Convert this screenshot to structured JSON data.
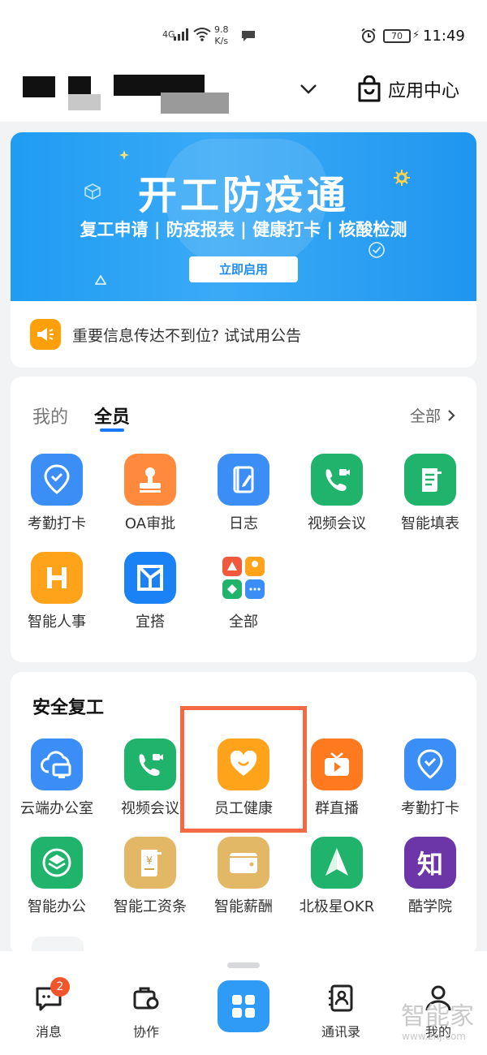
{
  "status_bar": {
    "network": "4G",
    "speed_value": "9.8",
    "speed_unit": "K/s",
    "battery": "70",
    "time": "11:49"
  },
  "header": {
    "app_center_label": "应用中心"
  },
  "banner": {
    "title": "开工防疫通",
    "subtitle": "复工申请 | 防疫报表 | 健康打卡 | 核酸检测",
    "button_label": "立即启用"
  },
  "notice": {
    "text": "重要信息传达不到位? 试试用公告"
  },
  "apps_section": {
    "tabs": [
      {
        "label": "我的",
        "active": false
      },
      {
        "label": "全员",
        "active": true
      }
    ],
    "see_all_label": "全部",
    "items": [
      {
        "label": "考勤打卡",
        "color": "#3b8ef5",
        "icon": "location-check-icon"
      },
      {
        "label": "OA审批",
        "color": "#ff8a3d",
        "icon": "stamp-icon"
      },
      {
        "label": "日志",
        "color": "#3b8ef5",
        "icon": "notebook-pen-icon"
      },
      {
        "label": "视频会议",
        "color": "#1fb36b",
        "icon": "video-phone-icon"
      },
      {
        "label": "智能填表",
        "color": "#1fb36b",
        "icon": "form-scroll-icon"
      },
      {
        "label": "智能人事",
        "color": "#ffa31a",
        "icon": "h-icon"
      },
      {
        "label": "宜搭",
        "color": "#1a82f5",
        "icon": "yida-icon"
      },
      {
        "label": "全部",
        "color": "#ffffff",
        "icon": "all-apps-icon"
      }
    ]
  },
  "safety_section": {
    "title": "安全复工",
    "items": [
      {
        "label": "云端办公室",
        "color": "#3b8ef5",
        "icon": "cloud-office-icon"
      },
      {
        "label": "视频会议",
        "color": "#1fb36b",
        "icon": "video-phone-icon"
      },
      {
        "label": "员工健康",
        "color": "#ffa31a",
        "icon": "heart-smile-icon"
      },
      {
        "label": "群直播",
        "color": "#ff7a1f",
        "icon": "live-tv-icon"
      },
      {
        "label": "考勤打卡",
        "color": "#3b8ef5",
        "icon": "location-check-icon"
      },
      {
        "label": "智能办公",
        "color": "#1fb36b",
        "icon": "layers-icon"
      },
      {
        "label": "智能工资条",
        "color": "#e2b766",
        "icon": "salary-slip-icon"
      },
      {
        "label": "智能薪酬",
        "color": "#e2b766",
        "icon": "wallet-icon"
      },
      {
        "label": "北极星OKR",
        "color": "#1fb36b",
        "icon": "compass-arrow-icon"
      },
      {
        "label": "酷学院",
        "color": "#6c35a8",
        "icon": "zhi-icon"
      }
    ],
    "zhi_glyph": "知",
    "salary_glyph": "¥"
  },
  "bottom_nav": {
    "items": [
      {
        "label": "消息",
        "badge": "2"
      },
      {
        "label": "协作"
      },
      {
        "label": "通讯录"
      },
      {
        "label": "我的"
      }
    ]
  },
  "watermark": {
    "main": "智能家",
    "sub": "www.znj.com"
  }
}
